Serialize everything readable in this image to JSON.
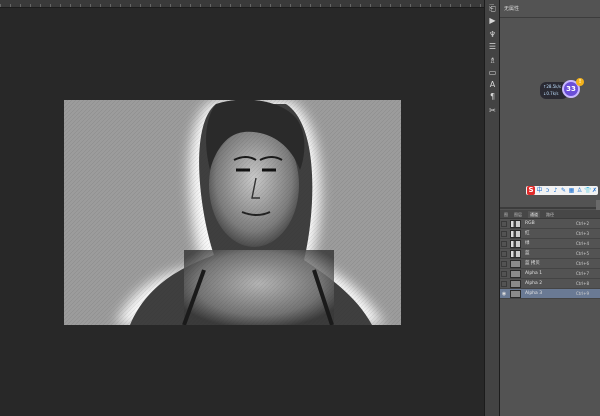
{
  "properties_panel": {
    "title": "无属性"
  },
  "widget": {
    "line1": "↑28.5k/s",
    "line2": "↓0.7k/s",
    "score": "33",
    "badge": "!"
  },
  "ime": {
    "logo": "S",
    "icons": [
      "中",
      "ɔ",
      "♪",
      "✎",
      "▦",
      "♙",
      "👕",
      "✗"
    ]
  },
  "channels_panel": {
    "tabs": [
      {
        "label": "图",
        "active": false
      },
      {
        "label": "图层",
        "active": false
      },
      {
        "label": "通道",
        "active": true
      },
      {
        "label": "路径",
        "active": false
      }
    ],
    "rows": [
      {
        "name": "RGB",
        "shortcut": "Ctrl+2",
        "visible": true,
        "thumb": "photo",
        "selected": false
      },
      {
        "name": "红",
        "shortcut": "Ctrl+3",
        "visible": true,
        "thumb": "photo",
        "selected": false
      },
      {
        "name": "绿",
        "shortcut": "Ctrl+4",
        "visible": true,
        "thumb": "photo",
        "selected": false
      },
      {
        "name": "蓝",
        "shortcut": "Ctrl+5",
        "visible": true,
        "thumb": "photo",
        "selected": false
      },
      {
        "name": "蓝 拷贝",
        "shortcut": "Ctrl+6",
        "visible": false,
        "thumb": "gray",
        "selected": false
      },
      {
        "name": "Alpha 1",
        "shortcut": "Ctrl+7",
        "visible": false,
        "thumb": "gray",
        "selected": false
      },
      {
        "name": "Alpha 2",
        "shortcut": "Ctrl+8",
        "visible": false,
        "thumb": "gray",
        "selected": false
      },
      {
        "name": "Alpha 3",
        "shortcut": "Ctrl+9",
        "visible": true,
        "thumb": "gray",
        "selected": true
      }
    ]
  },
  "toolstrip": [
    "history-icon",
    "play-icon",
    "brush-presets-icon",
    "adjustments-icon",
    "stamp-icon",
    "layer-comps-icon",
    "character-icon",
    "paragraph-icon",
    "tool-presets-icon"
  ],
  "colors": {
    "canvas_bg": "#282828",
    "panel_bg": "#535353",
    "selected_row": "#6a7a94",
    "document_bg": "#9c9c9c"
  }
}
